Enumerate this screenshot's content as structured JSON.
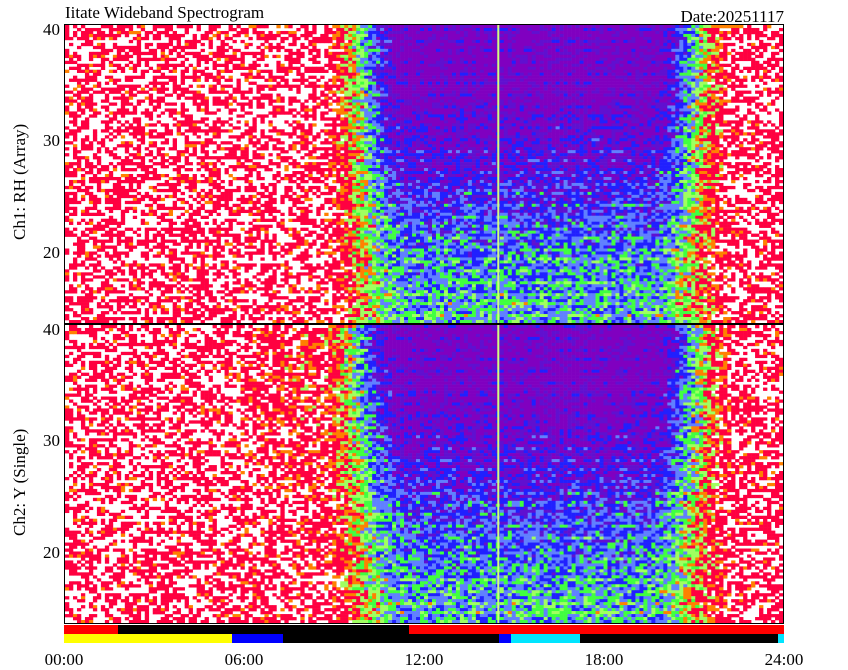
{
  "header": {
    "title": "Iitate Wideband Spectrogram",
    "date_text": "Date:20251117"
  },
  "colors": {
    "white": "#ffffff",
    "red": "#ff0040",
    "orange": "#ff8000",
    "green": "#40ff40",
    "light_green": "#a0ff60",
    "blue": "#2020ff",
    "light_blue": "#6080ff",
    "purple": "#8000c0",
    "violet": "#6010d0"
  },
  "chart_data": {
    "type": "heatmap",
    "title": "Iitate Wideband Spectrogram",
    "x_ticks": [
      "00:00",
      "06:00",
      "12:00",
      "18:00",
      "24:00"
    ],
    "xlim_hours": [
      0,
      24
    ],
    "panels": [
      {
        "name": "Ch1: RH (Array)",
        "ylabel": "Ch1: RH (Array)",
        "y_ticks": [
          20,
          30,
          40
        ],
        "ylim": [
          15.5,
          40.5
        ]
      },
      {
        "name": "Ch2: Y (Single)",
        "ylabel": "Ch2: Y (Single)",
        "y_ticks": [
          20,
          30,
          40
        ],
        "ylim": [
          15.5,
          40.5
        ]
      }
    ],
    "status_rows": [
      {
        "row": "top",
        "segments": [
          {
            "start": 0.0,
            "end": 1.8,
            "color": "#ff0000"
          },
          {
            "start": 1.8,
            "end": 11.5,
            "color": "#000000"
          },
          {
            "start": 11.5,
            "end": 24.0,
            "color": "#ff0000"
          }
        ]
      },
      {
        "row": "bottom",
        "segments": [
          {
            "start": 0.0,
            "end": 5.6,
            "color": "#ffff00"
          },
          {
            "start": 5.6,
            "end": 7.3,
            "color": "#0000ff"
          },
          {
            "start": 7.3,
            "end": 14.5,
            "color": "#000000"
          },
          {
            "start": 14.5,
            "end": 14.9,
            "color": "#0000ff"
          },
          {
            "start": 14.9,
            "end": 17.2,
            "color": "#00e5ff"
          },
          {
            "start": 17.2,
            "end": 23.8,
            "color": "#000000"
          },
          {
            "start": 23.8,
            "end": 24.0,
            "color": "#00e5ff"
          }
        ]
      }
    ]
  }
}
